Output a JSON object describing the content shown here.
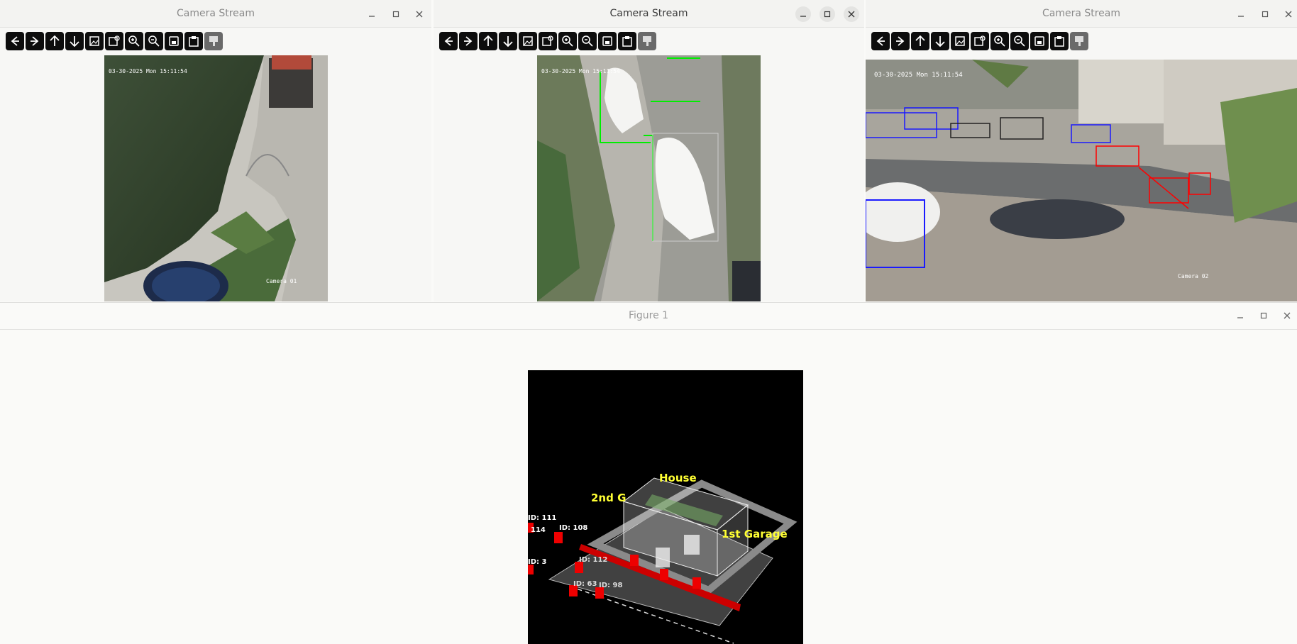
{
  "windows": [
    {
      "title": "Camera Stream",
      "timestamp": "03-30-2025 Mon 15:11:54",
      "camera_label": "Camera 01"
    },
    {
      "title": "Camera Stream",
      "timestamp": "03-30-2025 Mon 15:11:54",
      "camera_label": ""
    },
    {
      "title": "Camera Stream",
      "timestamp": "03-30-2025 Mon 15:11:54",
      "camera_label": "Camera 02"
    }
  ],
  "toolbar_icons": [
    "arrow-left-icon",
    "arrow-right-icon",
    "arrow-up-icon",
    "arrow-down-icon",
    "image-icon",
    "image-search-icon",
    "zoom-in-icon",
    "zoom-out-icon",
    "save-icon",
    "clipboard-icon",
    "brush-icon"
  ],
  "figure": {
    "title": "Figure 1",
    "labels": {
      "house": "House",
      "garage2": "2nd G",
      "garage1": "1st Garage"
    },
    "ids": [
      "ID: 111",
      "114",
      "ID: 108",
      "ID: 3",
      "ID: 112",
      "ID: 63",
      "ID: 98"
    ]
  },
  "colors": {
    "track_red": "#ff0000",
    "label_yellow": "#ffff33",
    "box_green": "#00ee00",
    "box_blue": "#1a1aff"
  }
}
